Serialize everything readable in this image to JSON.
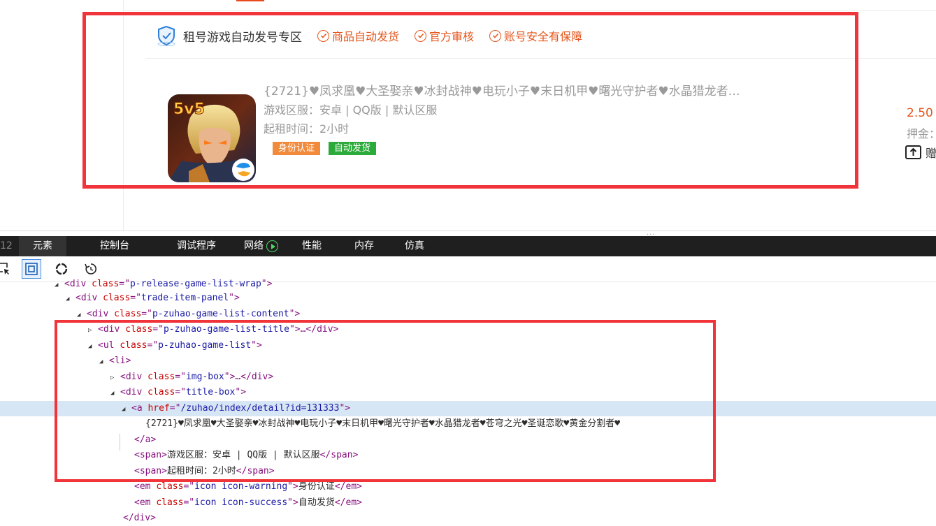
{
  "zone": {
    "icon": "shield-check-icon",
    "title": "租号游戏自动发号专区",
    "features": [
      "商品自动发货",
      "官方审核",
      "账号安全有保障"
    ],
    "feature_icon": "check-circle-icon",
    "accent": "#e4561c"
  },
  "item": {
    "image": "game-icon-5v5",
    "title": "{2721}♥凤求凰♥大圣娶亲♥冰封战神♥电玩小子♥末日机甲♥曙光守护者♥水晶猎龙者…",
    "region": "游戏区服：安卓 | QQ版 | 默认区服",
    "rent_time": "起租时间：2小时",
    "tags": {
      "warning": "身份认证",
      "success": "自动发货"
    },
    "price": "2.50",
    "deposit": "押金：",
    "share_label": "赠"
  },
  "devtools": {
    "tab_stub": "12",
    "tabs": [
      "元素",
      "控制台",
      "调试程序",
      "网络",
      "性能",
      "内存",
      "仿真"
    ],
    "active_tab": "元素",
    "tree": {
      "line0": {
        "tag": "div",
        "attr": "class",
        "value": "p-release-game-list-wrap"
      },
      "line1": {
        "tag": "div",
        "attr": "class",
        "value": "trade-item-panel"
      },
      "line2": {
        "tag": "div",
        "attr": "class",
        "value": "p-zuhao-game-list-content"
      },
      "line3": {
        "tag": "div",
        "attr": "class",
        "value": "p-zuhao-game-list-title",
        "ellipsis": "…</div>"
      },
      "line4": {
        "tag": "ul",
        "attr": "class",
        "value": "p-zuhao-game-list"
      },
      "line5": {
        "tag": "li"
      },
      "line6": {
        "tag": "div",
        "attr": "class",
        "value": "img-box",
        "ellipsis": "…</div>"
      },
      "line7": {
        "tag": "div",
        "attr": "class",
        "value": "title-box"
      },
      "line8": {
        "tag": "a",
        "attr": "href",
        "value": "/zuhao/index/detail?id=131333"
      },
      "line9": {
        "text": "{2721}♥凤求凰♥大圣娶亲♥冰封战神♥电玩小子♥末日机甲♥曙光守护者♥水晶猎龙者♥苍穹之光♥圣诞恋歌♥黄金分割者♥"
      },
      "line10": {
        "close": "</a>"
      },
      "line11": {
        "tag": "span",
        "text": "游戏区服：安卓 | QQ版 | 默认区服"
      },
      "line12": {
        "tag": "span",
        "text": "起租时间：2小时"
      },
      "line13": {
        "tag": "em",
        "attr": "class",
        "value": "icon icon-warning",
        "text": "身份认证"
      },
      "line14": {
        "tag": "em",
        "attr": "class",
        "value": "icon icon-success",
        "text": "自动发货"
      },
      "line15": {
        "close": "</div>"
      }
    }
  }
}
